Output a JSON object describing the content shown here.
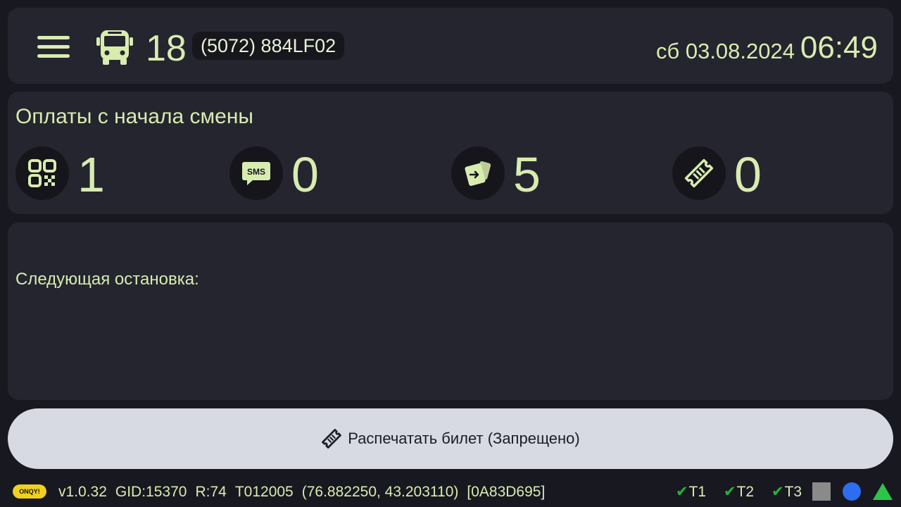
{
  "header": {
    "route_number": "18",
    "vehicle_id": "(5072) 884LF02",
    "date": "сб 03.08.2024",
    "time": "06:49",
    "icons": {
      "menu": "hamburger-menu-icon",
      "bus": "bus-icon"
    }
  },
  "payments": {
    "title": "Оплаты с начала смены",
    "items": [
      {
        "icon": "qr-code-icon",
        "value": "1"
      },
      {
        "icon": "sms-icon",
        "value": "0"
      },
      {
        "icon": "card-payment-icon",
        "value": "5"
      },
      {
        "icon": "ticket-icon",
        "value": "0"
      }
    ]
  },
  "next_stop": {
    "label": "Следующая остановка:",
    "value": ""
  },
  "print_button": {
    "label": "Распечатать билет (Запрещено)",
    "icon": "ticket-icon"
  },
  "status_bar": {
    "logo_text": "ONQY!",
    "version": "v1.0.32",
    "gid": "GID:15370",
    "r": "R:74",
    "terminal_id": "T012005",
    "coordinates": "(76.882250, 43.203110)",
    "hex_id": "[0A83D695]",
    "terminals": [
      {
        "label": "T1",
        "ok": true
      },
      {
        "label": "T2",
        "ok": true
      },
      {
        "label": "T3",
        "ok": true
      }
    ],
    "indicator_colors": {
      "square": "#8a8a8a",
      "dot": "#2e6cf0",
      "triangle": "#2ec44a"
    }
  },
  "colors": {
    "accent": "#d8ecb0",
    "panel": "#25252f",
    "background": "#181820",
    "button": "#d7d9e3"
  }
}
